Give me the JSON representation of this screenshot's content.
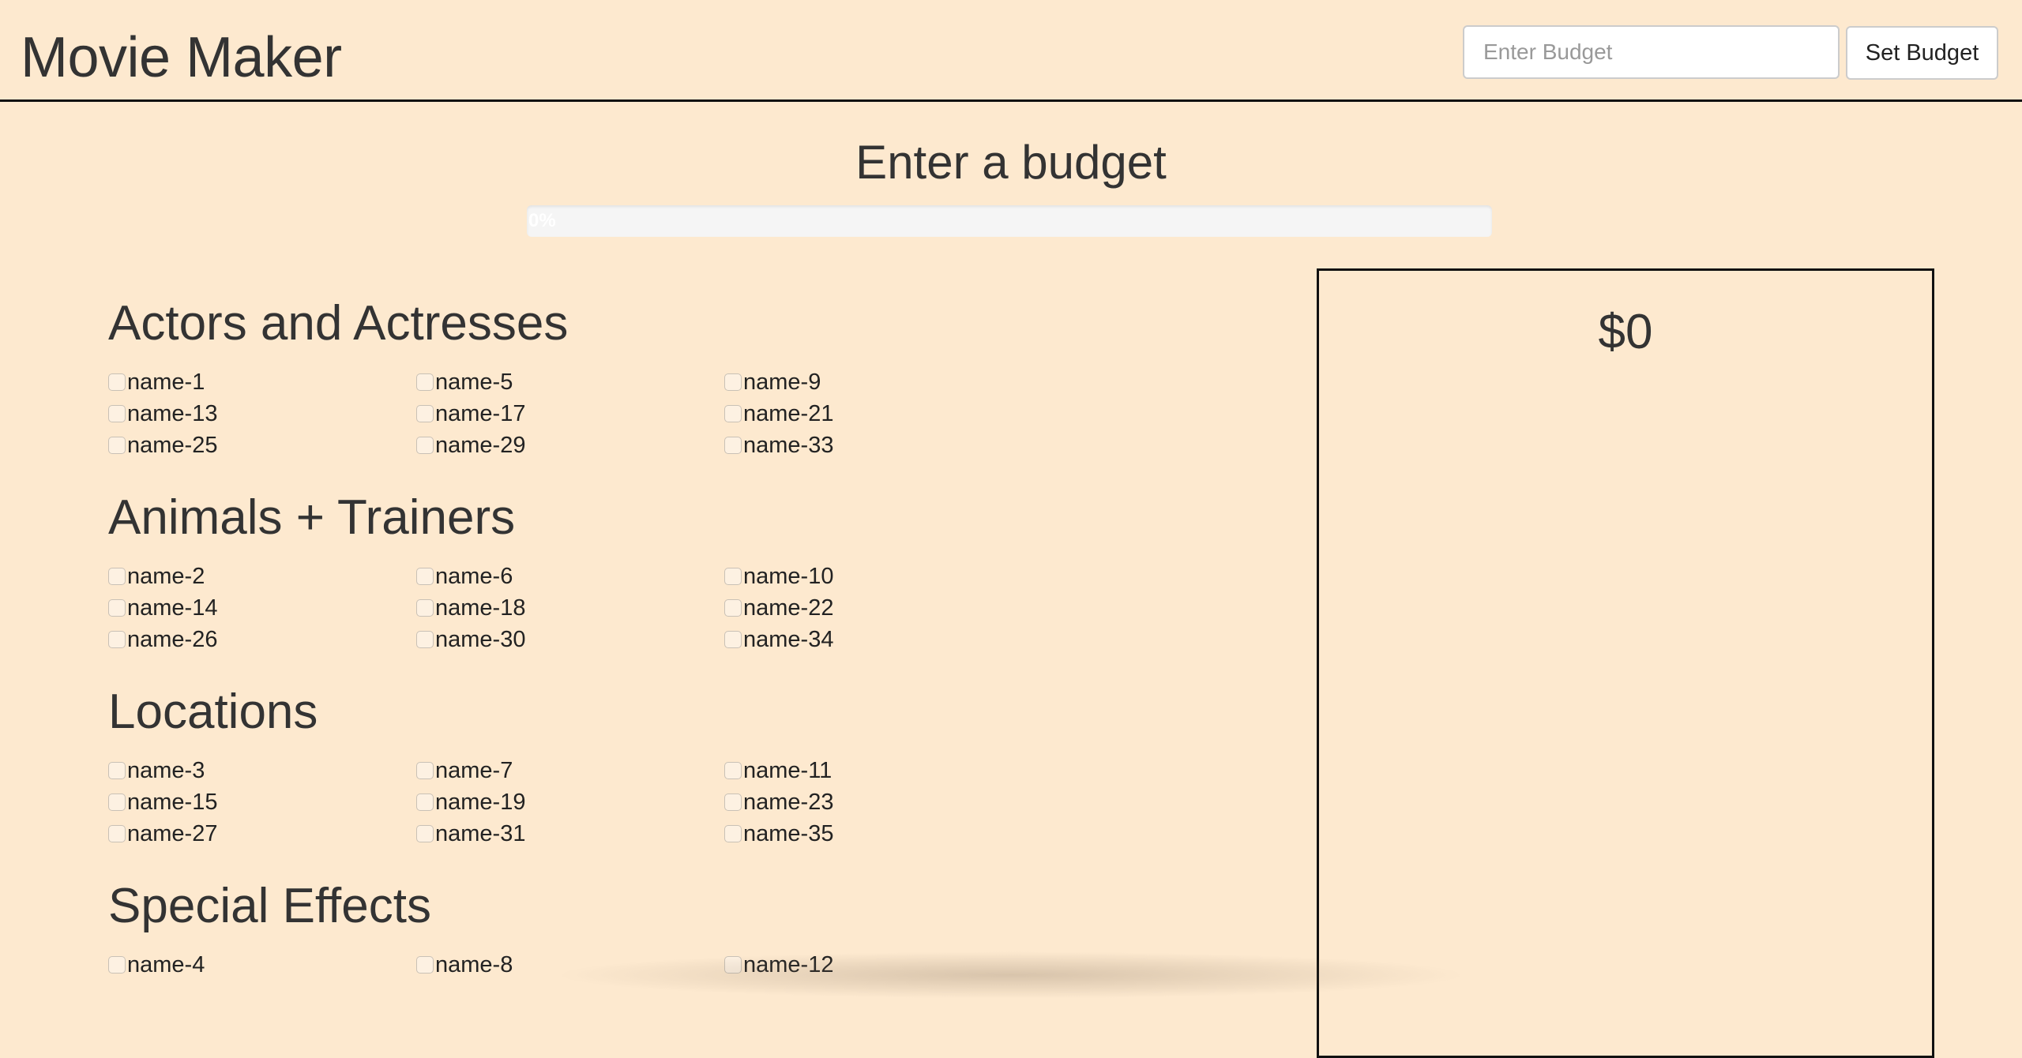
{
  "header": {
    "app_title": "Movie Maker",
    "budget_placeholder": "Enter Budget",
    "budget_value": "",
    "set_budget_label": "Set Budget"
  },
  "status": {
    "heading": "Enter a budget",
    "progress_label": "0%",
    "progress_fraction": 0
  },
  "sections": [
    {
      "title": "Actors and Actresses",
      "options": [
        "name-1",
        "name-5",
        "name-9",
        "name-13",
        "name-17",
        "name-21",
        "name-25",
        "name-29",
        "name-33"
      ]
    },
    {
      "title": "Animals + Trainers",
      "options": [
        "name-2",
        "name-6",
        "name-10",
        "name-14",
        "name-18",
        "name-22",
        "name-26",
        "name-30",
        "name-34"
      ]
    },
    {
      "title": "Locations",
      "options": [
        "name-3",
        "name-7",
        "name-11",
        "name-15",
        "name-19",
        "name-23",
        "name-27",
        "name-31",
        "name-35"
      ]
    },
    {
      "title": "Special Effects",
      "options": [
        "name-4",
        "name-8",
        "name-12"
      ]
    }
  ],
  "summary": {
    "total": "$0"
  },
  "colors": {
    "background": "#fde9cf",
    "text": "#333333",
    "border": "#111111",
    "progress_track": "#f5f5f5"
  }
}
